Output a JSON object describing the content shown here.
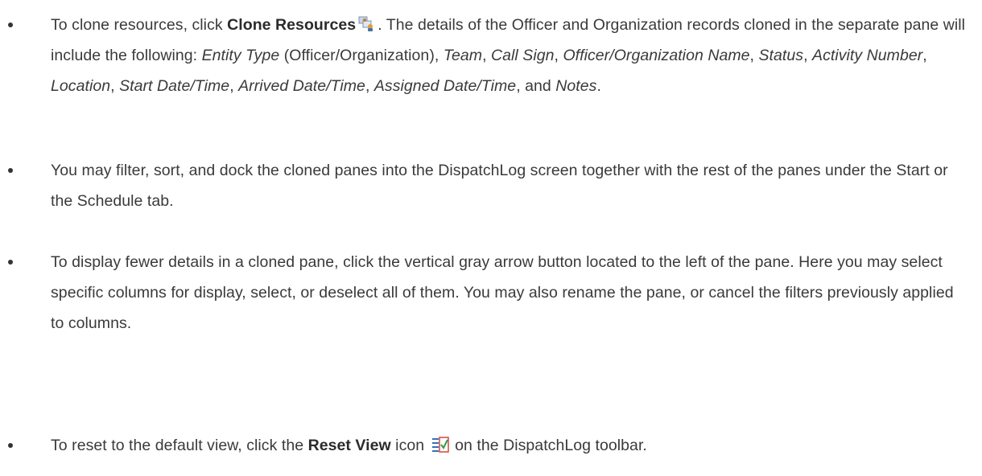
{
  "bullets": [
    {
      "pre": "To clone resources, click ",
      "bold": "Clone Resources",
      "icon": "clone-resources-icon",
      "post": ". The details of the Officer and Organization records cloned in the separate pane will include the following: ",
      "fields": [
        {
          "label": "Entity Type",
          "after": " (Officer/Organization), "
        },
        {
          "label": "Team",
          "after": ", "
        },
        {
          "label": "Call Sign",
          "after": ", "
        },
        {
          "label": "Officer/Organization Name",
          "after": ", "
        },
        {
          "label": "Status",
          "after": ", "
        },
        {
          "label": "Activity Number",
          "after": ", "
        },
        {
          "label": "Location",
          "after": ", "
        },
        {
          "label": "Start Date/Time",
          "after": ", "
        },
        {
          "label": "Arrived Date/Time",
          "after": ", "
        },
        {
          "label": "Assigned Date/Time",
          "after": ", and "
        },
        {
          "label": "Notes",
          "after": "."
        }
      ]
    },
    {
      "text": "You may filter, sort, and dock the cloned panes into the DispatchLog screen together with the rest of the panes under the Start or the Schedule tab."
    },
    {
      "text": "To display fewer details in a cloned pane, click the vertical gray arrow button located to the left of the pane. Here you may select specific columns for display, select, or deselect all of them. You may also rename the pane, or cancel the filters previously applied to columns."
    },
    {
      "pre": "To reset to the default view, click the ",
      "bold": "Reset View",
      "mid": " icon ",
      "icon": "reset-view-icon",
      "post": " on the DispatchLog toolbar."
    }
  ]
}
